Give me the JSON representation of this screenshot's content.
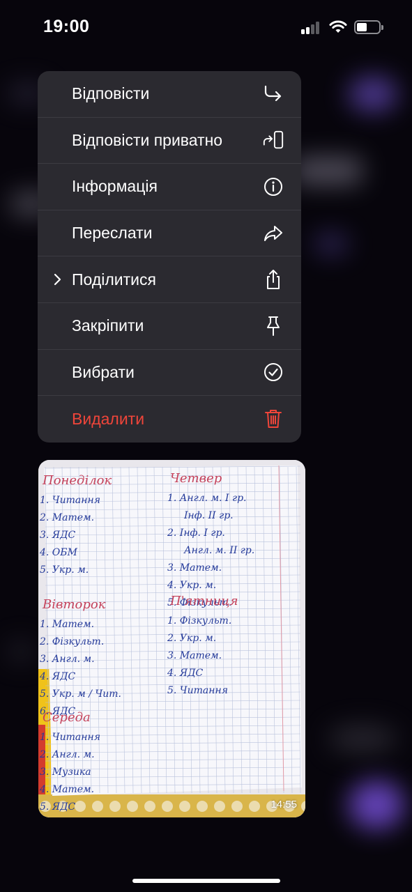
{
  "status_bar": {
    "time": "19:00"
  },
  "menu": {
    "items": [
      {
        "label": "Відповісти",
        "icon": "reply-icon"
      },
      {
        "label": "Відповісти приватно",
        "icon": "reply-privately-icon"
      },
      {
        "label": "Інформація",
        "icon": "info-icon"
      },
      {
        "label": "Переслати",
        "icon": "forward-icon"
      },
      {
        "label": "Поділитися",
        "icon": "share-icon",
        "submenu": true
      },
      {
        "label": "Закріпити",
        "icon": "pin-icon"
      },
      {
        "label": "Вибрати",
        "icon": "checkmark-circle-icon"
      },
      {
        "label": "Видалити",
        "icon": "trash-icon",
        "destructive": true,
        "color": "#f0453a"
      }
    ]
  },
  "message": {
    "timestamp": "14:55",
    "photo": {
      "left_column": [
        {
          "heading": "Понеділок",
          "items": [
            "1. Читання",
            "2. Матем.",
            "3. ЯДС",
            "4. ОБМ",
            "5. Укр. м."
          ]
        },
        {
          "heading": "Вівторок",
          "items": [
            "1. Матем.",
            "2. Фізкульт.",
            "3. Англ. м.",
            "4. ЯДС",
            "5. Укр. м / Чит.",
            "6. ЯДС"
          ]
        },
        {
          "heading": "Середа",
          "items": [
            "1. Читання",
            "2. Англ. м.",
            "3. Музика",
            "4. Матем.",
            "5. ЯДС"
          ]
        }
      ],
      "right_column": [
        {
          "heading": "Четвер",
          "items": [
            "1. Англ. м. I гр.",
            "Інф. II гр.",
            "2. Інф. I гр.",
            "Англ. м. II гр.",
            "3. Матем.",
            "4. Укр. м.",
            "5. Фізкульт."
          ]
        },
        {
          "heading": "П'ятниця",
          "items": [
            "1. Фізкульт.",
            "2. Укр. м.",
            "3. Матем.",
            "4. ЯДС",
            "5. Читання"
          ]
        }
      ]
    }
  },
  "colors": {
    "menu_bg": "#2b2a30",
    "destructive": "#f0453a",
    "heading_ink": "#c4415a",
    "ink": "#243a9a"
  }
}
